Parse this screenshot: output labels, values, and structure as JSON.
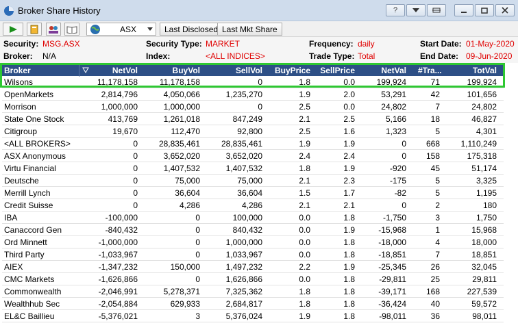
{
  "window": {
    "title": "Broker Share History"
  },
  "toolbar": {
    "exchange_value": "ASX",
    "last_disclosed_label": "Last Disclosed",
    "last_mkt_share_label": "Last Mkt Share"
  },
  "info": {
    "security_label": "Security:",
    "security_value": "MSG.ASX",
    "broker_label": "Broker:",
    "broker_value": "N/A",
    "security_type_label": "Security Type:",
    "security_type_value": "MARKET",
    "index_label": "Index:",
    "index_value": "<ALL INDICES>",
    "frequency_label": "Frequency:",
    "frequency_value": "daily",
    "trade_type_label": "Trade Type:",
    "trade_type_value": "Total",
    "start_date_label": "Start Date:",
    "start_date_value": "01-May-2020",
    "end_date_label": "End Date:",
    "end_date_value": "09-Jun-2020"
  },
  "table": {
    "headers": [
      "Broker",
      "NetVol",
      "BuyVol",
      "SellVol",
      "BuyPrice",
      "SellPrice",
      "NetVal",
      "#Tra...",
      "TotVal"
    ],
    "rows": [
      [
        "Wilsons",
        "11,178,158",
        "11,178,158",
        "0",
        "1.8",
        "0.0",
        "199,924",
        "71",
        "199,924"
      ],
      [
        "OpenMarkets",
        "2,814,796",
        "4,050,066",
        "1,235,270",
        "1.9",
        "2.0",
        "53,291",
        "42",
        "101,656"
      ],
      [
        "Morrison",
        "1,000,000",
        "1,000,000",
        "0",
        "2.5",
        "0.0",
        "24,802",
        "7",
        "24,802"
      ],
      [
        "State One Stock",
        "413,769",
        "1,261,018",
        "847,249",
        "2.1",
        "2.5",
        "5,166",
        "18",
        "46,827"
      ],
      [
        "Citigroup",
        "19,670",
        "112,470",
        "92,800",
        "2.5",
        "1.6",
        "1,323",
        "5",
        "4,301"
      ],
      [
        "<ALL BROKERS>",
        "0",
        "28,835,461",
        "28,835,461",
        "1.9",
        "1.9",
        "0",
        "668",
        "1,110,249"
      ],
      [
        "ASX Anonymous",
        "0",
        "3,652,020",
        "3,652,020",
        "2.4",
        "2.4",
        "0",
        "158",
        "175,318"
      ],
      [
        "Virtu Financial",
        "0",
        "1,407,532",
        "1,407,532",
        "1.8",
        "1.9",
        "-920",
        "45",
        "51,174"
      ],
      [
        "Deutsche",
        "0",
        "75,000",
        "75,000",
        "2.1",
        "2.3",
        "-175",
        "5",
        "3,325"
      ],
      [
        "Merrill Lynch",
        "0",
        "36,604",
        "36,604",
        "1.5",
        "1.7",
        "-82",
        "5",
        "1,195"
      ],
      [
        "Credit Suisse",
        "0",
        "4,286",
        "4,286",
        "2.1",
        "2.1",
        "0",
        "2",
        "180"
      ],
      [
        "IBA",
        "-100,000",
        "0",
        "100,000",
        "0.0",
        "1.8",
        "-1,750",
        "3",
        "1,750"
      ],
      [
        "Canaccord Gen",
        "-840,432",
        "0",
        "840,432",
        "0.0",
        "1.9",
        "-15,968",
        "1",
        "15,968"
      ],
      [
        "Ord Minnett",
        "-1,000,000",
        "0",
        "1,000,000",
        "0.0",
        "1.8",
        "-18,000",
        "4",
        "18,000"
      ],
      [
        "Third Party",
        "-1,033,967",
        "0",
        "1,033,967",
        "0.0",
        "1.8",
        "-18,851",
        "7",
        "18,851"
      ],
      [
        "AIEX",
        "-1,347,232",
        "150,000",
        "1,497,232",
        "2.2",
        "1.9",
        "-25,345",
        "26",
        "32,045"
      ],
      [
        "CMC Markets",
        "-1,626,866",
        "0",
        "1,626,866",
        "0.0",
        "1.8",
        "-29,811",
        "25",
        "29,811"
      ],
      [
        "Commonwealth",
        "-2,046,991",
        "5,278,371",
        "7,325,362",
        "1.8",
        "1.8",
        "-39,171",
        "168",
        "227,539"
      ],
      [
        "Wealthhub Sec",
        "-2,054,884",
        "629,933",
        "2,684,817",
        "1.8",
        "1.8",
        "-36,424",
        "40",
        "59,572"
      ],
      [
        "EL&C Baillieu",
        "-5,376,021",
        "3",
        "5,376,024",
        "1.9",
        "1.8",
        "-98,011",
        "36",
        "98,011"
      ]
    ]
  },
  "colors": {
    "header_bg": "#2d4f86",
    "highlight_border": "#2ec832",
    "red_value": "#e00000"
  }
}
